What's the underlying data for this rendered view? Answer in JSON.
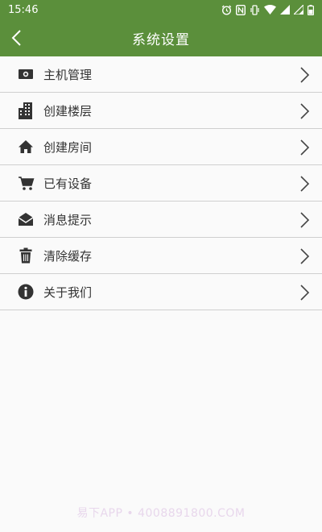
{
  "status_bar": {
    "time": "15:46"
  },
  "header": {
    "title": "系统设置"
  },
  "menu": {
    "items": [
      {
        "label": "主机管理",
        "icon": "host-icon"
      },
      {
        "label": "创建楼层",
        "icon": "building-icon"
      },
      {
        "label": "创建房间",
        "icon": "home-icon"
      },
      {
        "label": "已有设备",
        "icon": "cart-icon"
      },
      {
        "label": "消息提示",
        "icon": "envelope-icon"
      },
      {
        "label": "清除缓存",
        "icon": "trash-icon"
      },
      {
        "label": "关于我们",
        "icon": "info-icon"
      }
    ]
  },
  "watermark": "易下APP • 4008891800.COM",
  "colors": {
    "accent": "#5b8f3b",
    "icon": "#333333",
    "divider": "#cfcfcf"
  }
}
